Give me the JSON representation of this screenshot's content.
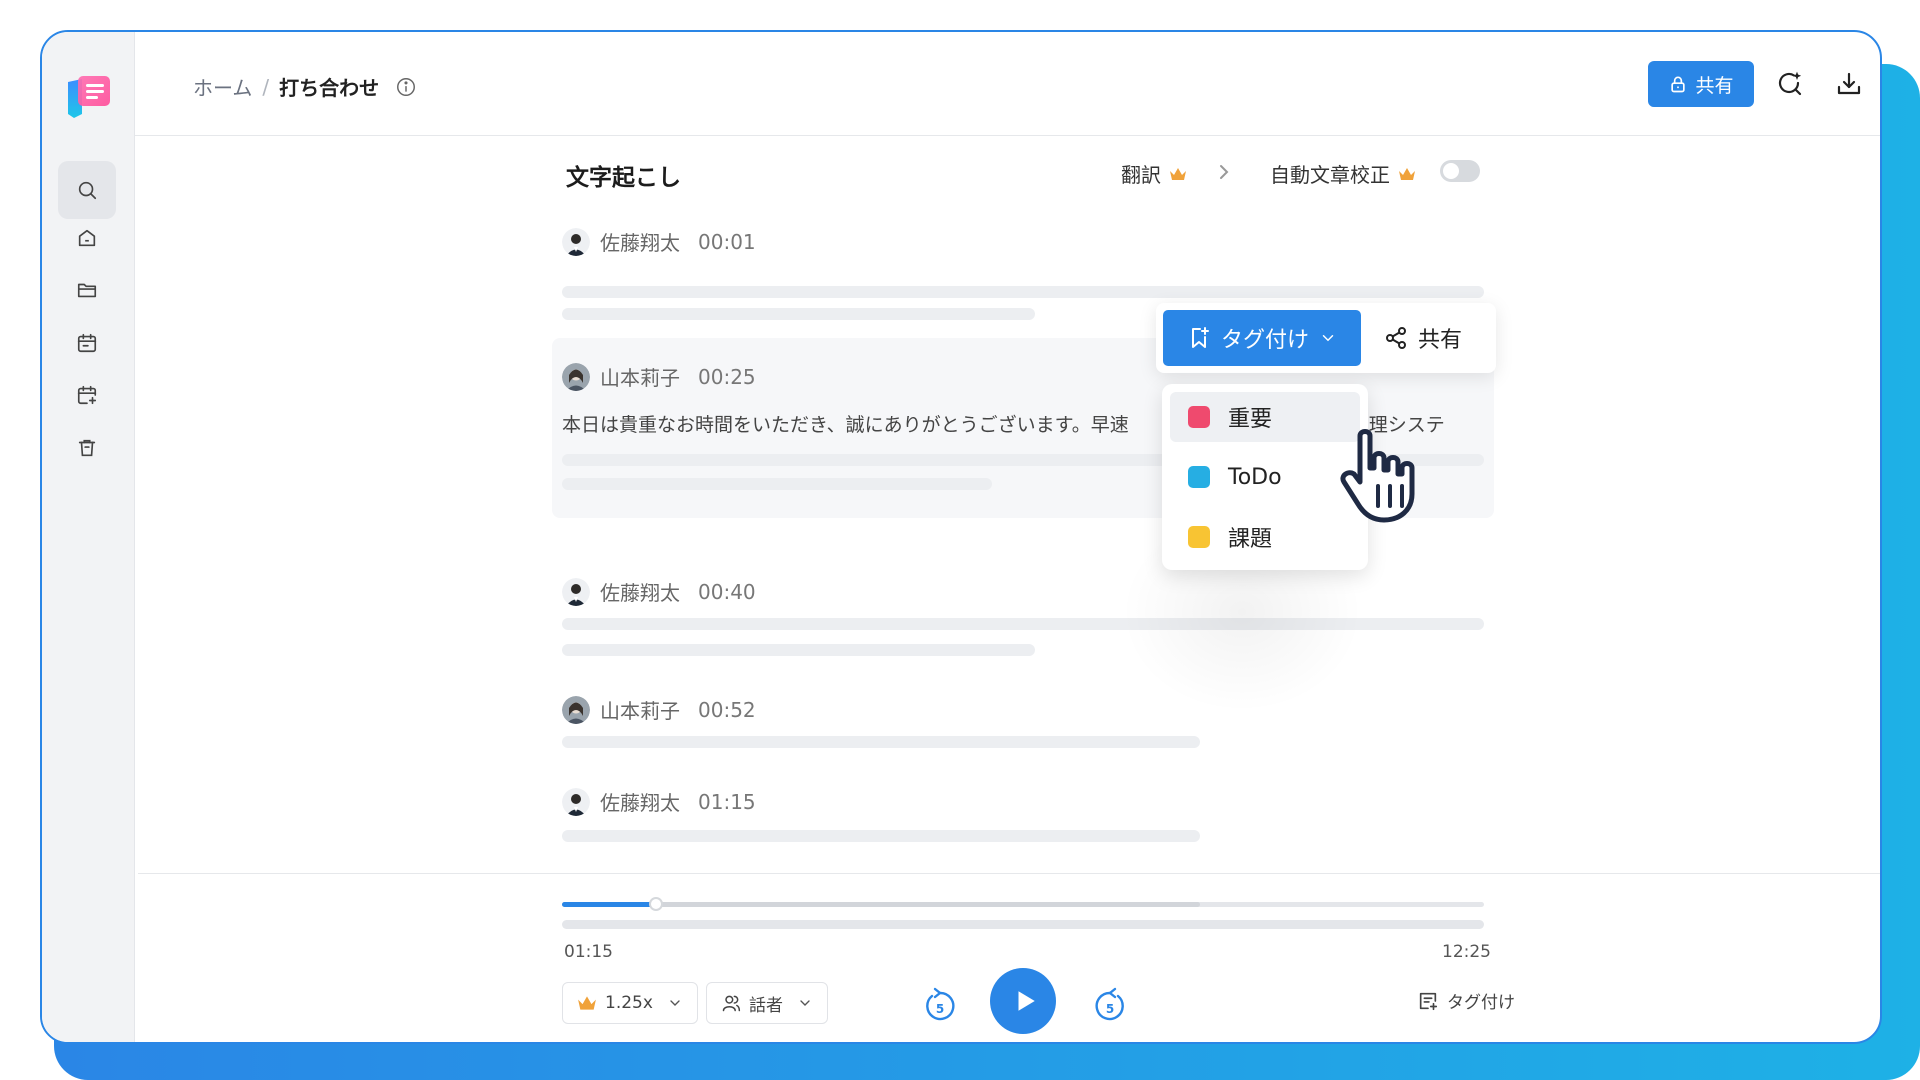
{
  "breadcrumb": {
    "home": "ホーム",
    "separator": "/",
    "current": "打ち合わせ"
  },
  "header": {
    "share_label": "共有"
  },
  "transcript": {
    "title": "文字起こし",
    "translate_label": "翻訳",
    "proofread_label": "自動文章校正",
    "proofread_enabled": false,
    "segments": [
      {
        "speaker": "佐藤翔太",
        "time": "00:01"
      },
      {
        "speaker": "山本莉子",
        "time": "00:25",
        "text": "本日は貴重なお時間をいただき、誠にありがとうございます。早速",
        "text_tail": "理システ"
      },
      {
        "speaker": "佐藤翔太",
        "time": "00:40"
      },
      {
        "speaker": "山本莉子",
        "time": "00:52"
      },
      {
        "speaker": "佐藤翔太",
        "time": "01:15"
      }
    ]
  },
  "tag_toolbar": {
    "tag_label": "タグ付け",
    "share_label": "共有"
  },
  "tag_menu": {
    "items": [
      {
        "label": "重要",
        "color": "#ef4a6e"
      },
      {
        "label": "ToDo",
        "color": "#26aee3"
      },
      {
        "label": "課題",
        "color": "#f8c433"
      }
    ]
  },
  "player": {
    "current_time": "01:15",
    "total_time": "12:25",
    "progress_fraction": 0.102,
    "buffered_fraction": 0.692,
    "speed": "1.25x",
    "speaker_filter": "話者",
    "skip_back_seconds": "5",
    "skip_forward_seconds": "5",
    "tag_label": "タグ付け"
  },
  "colors": {
    "accent": "#2a86e6",
    "crown": "#f0a23a"
  },
  "icons": [
    "logo-icon",
    "search-icon",
    "home-icon",
    "folder-icon",
    "calendar-icon",
    "calendar-add-icon",
    "trash-icon",
    "info-icon",
    "lock-icon",
    "ai-search-icon",
    "download-icon",
    "more-icon",
    "crown-icon",
    "chevron-right-icon",
    "bookmark-add-icon",
    "chevron-down-icon",
    "share-icon",
    "hand-pointer-icon",
    "replay-5-icon",
    "play-icon",
    "forward-5-icon",
    "person-icon",
    "tag-note-icon"
  ]
}
